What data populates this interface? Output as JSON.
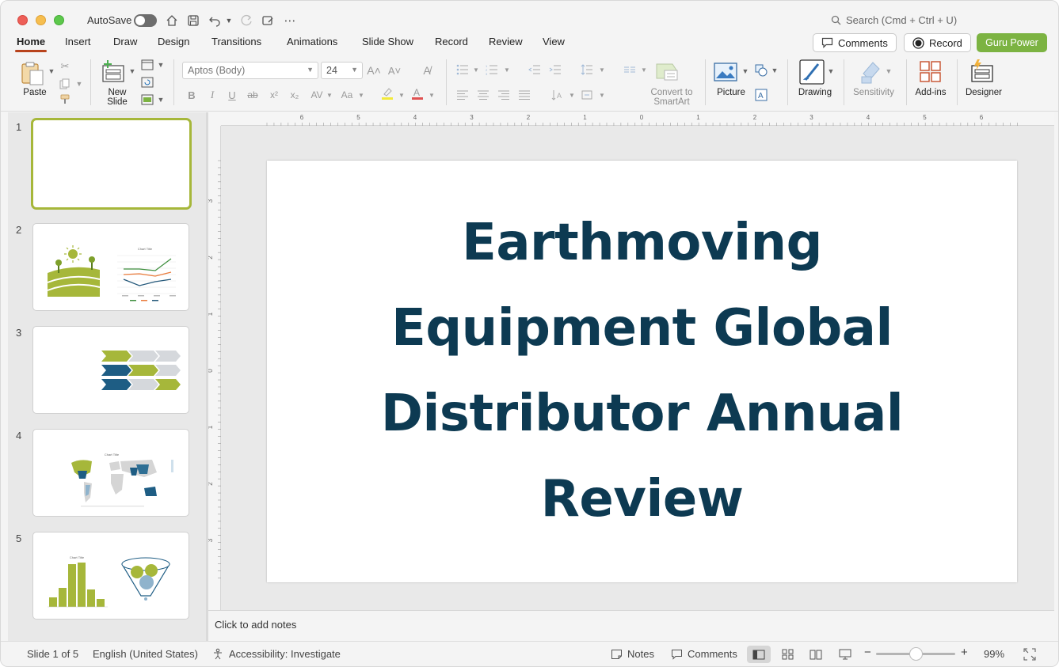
{
  "titlebar": {
    "autosave_label": "AutoSave",
    "search_placeholder": "Search (Cmd + Ctrl + U)"
  },
  "tabs": [
    "Home",
    "Insert",
    "Draw",
    "Design",
    "Transitions",
    "Animations",
    "Slide Show",
    "Record",
    "Review",
    "View"
  ],
  "active_tab": "Home",
  "tab_buttons": {
    "comments": "Comments",
    "record": "Record",
    "guru": "Guru Power"
  },
  "ribbon": {
    "paste": "Paste",
    "new_slide_line1": "New",
    "new_slide_line2": "Slide",
    "font_name": "Aptos (Body)",
    "font_size": "24",
    "convert_line1": "Convert to",
    "convert_line2": "SmartArt",
    "picture": "Picture",
    "drawing": "Drawing",
    "sensitivity": "Sensitivity",
    "addins": "Add-ins",
    "designer": "Designer"
  },
  "thumbnails": [
    {
      "number": "1"
    },
    {
      "number": "2",
      "chart_title": "Chart Title"
    },
    {
      "number": "3"
    },
    {
      "number": "4",
      "chart_title": "Chart Title"
    },
    {
      "number": "5",
      "chart_title": "Chart Title"
    }
  ],
  "ruler": {
    "h_labels": [
      "6",
      "5",
      "4",
      "3",
      "2",
      "1",
      "0",
      "1",
      "2",
      "3",
      "4",
      "5",
      "6"
    ],
    "v_labels": [
      "3",
      "2",
      "1",
      "0",
      "1",
      "2",
      "3"
    ]
  },
  "slide": {
    "title_lines": [
      "Earthmoving",
      "Equipment Global",
      "Distributor Annual",
      "Review"
    ]
  },
  "notes": {
    "placeholder": "Click to add notes"
  },
  "statusbar": {
    "slide_count": "Slide 1 of 5",
    "language": "English (United States)",
    "accessibility": "Accessibility: Investigate",
    "notes": "Notes",
    "comments": "Comments",
    "zoom": "99%"
  },
  "colors": {
    "accent": "#b8431c",
    "title": "#0d3a52",
    "lime": "#a6b73a",
    "guru": "#7cb342"
  }
}
